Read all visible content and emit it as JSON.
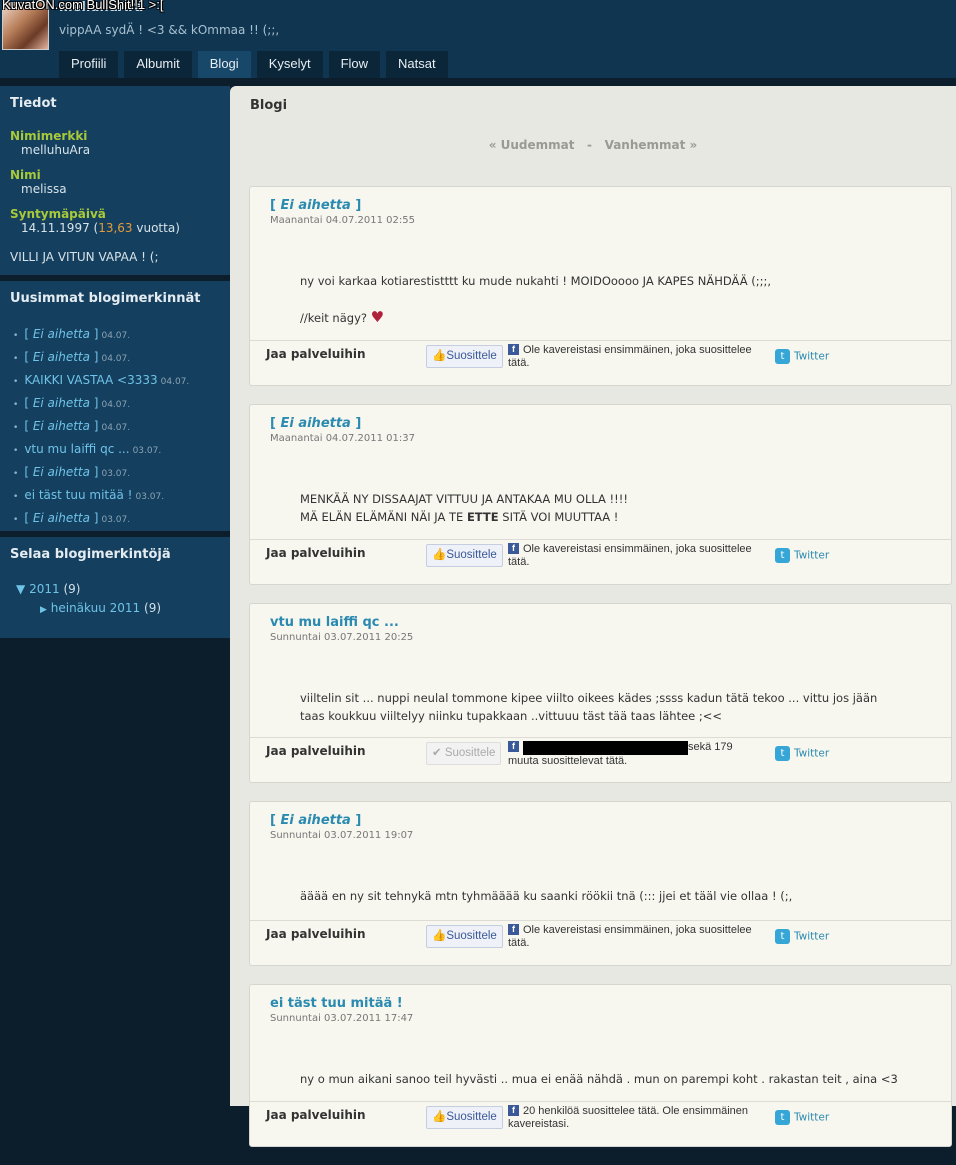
{
  "watermark": "KuvatON.com BullShit!!1 >:[",
  "profile": {
    "username": "melluhuAra",
    "status": "vippAA sydÄ ! <3 && kOmmaa !! (;;,"
  },
  "tabs": [
    "Profiili",
    "Albumit",
    "Blogi",
    "Kyselyt",
    "Flow",
    "Natsat"
  ],
  "sidebar": {
    "info": {
      "title": "Tiedot",
      "nick_label": "Nimimerkki",
      "nick": "melluhuAra",
      "name_label": "Nimi",
      "name": "melissa",
      "bday_label": "Syntymäpäivä",
      "bday": "14.11.1997 (",
      "age": "13,63",
      "age_suffix": " vuotta)",
      "motto": "VILLI JA VITUN VAPAA ! (;"
    },
    "recent": {
      "title": "Uusimmat blogimerkinnät",
      "items": [
        {
          "pre": "[ ",
          "title": "Ei aihetta",
          "post": " ]",
          "date": "04.07."
        },
        {
          "pre": "[ ",
          "title": "Ei aihetta",
          "post": " ]",
          "date": "04.07."
        },
        {
          "pre": "",
          "title": "KAIKKI VASTAA <3333",
          "post": "",
          "date": "04.07."
        },
        {
          "pre": "[ ",
          "title": "Ei aihetta",
          "post": " ]",
          "date": "04.07."
        },
        {
          "pre": "[ ",
          "title": "Ei aihetta",
          "post": " ]",
          "date": "04.07."
        },
        {
          "pre": "",
          "title": "vtu mu laiffi qc ...",
          "post": "",
          "date": "03.07."
        },
        {
          "pre": "[ ",
          "title": "Ei aihetta",
          "post": " ]",
          "date": "03.07."
        },
        {
          "pre": "",
          "title": "ei täst tuu mitää !",
          "post": "",
          "date": "03.07."
        },
        {
          "pre": "[ ",
          "title": "Ei aihetta",
          "post": " ]",
          "date": "03.07."
        }
      ]
    },
    "browse": {
      "title": "Selaa blogimerkintöjä",
      "year": "2011",
      "year_count": "(9)",
      "month": "heinäkuu 2011",
      "month_count": "(9)"
    }
  },
  "main": {
    "title": "Blogi",
    "newer": "« Uudemmat",
    "sep": "-",
    "older": "Vanhemmat »"
  },
  "share": {
    "label": "Jaa palveluihin",
    "recommend": "Suosittele",
    "twitter": "Twitter",
    "first": "Ole kavereistasi ensimmäinen, joka suosittelee tätä."
  },
  "posts": [
    {
      "title": "Ei aihetta",
      "bracket": true,
      "date": "Maanantai 04.07.2011 02:55",
      "lines": [
        "ny voi karkaa kotiarestistttt ku mude nukahti ! MOIDOoooo JA KAPES NÄHDÄÄ (;;;,",
        "",
        "//keit nägy?"
      ]
    },
    {
      "title": "Ei aihetta",
      "bracket": true,
      "date": "Maanantai 04.07.2011 01:37",
      "lines": [
        "MENKÄÄ NY DISSAAJAT VITTUU JA ANTAKAA MU OLLA !!!!"
      ],
      "line2a": "MÄ ELÄN ELÄMÄNI NÄI JA TE ",
      "line2b": "ETTE",
      "line2c": " SITÄ VOI MUUTTAA !"
    },
    {
      "title": "vtu mu laiffi qc ...",
      "bracket": false,
      "date": "Sunnuntai 03.07.2011 20:25",
      "lines": [
        "viiltelin sit ... nuppi neulal tommone kipee viilto oikees kädes ;ssss kadun tätä tekoo ... vittu jos jään",
        "taas koukkuu viiltelyy niinku tupakkaan ..vittuuu täst tää taas lähtee ;<<"
      ],
      "fb_suffix": "sekä 179 muuta suosittelevat tätä."
    },
    {
      "title": "Ei aihetta",
      "bracket": true,
      "date": "Sunnuntai 03.07.2011 19:07",
      "lines": [
        "ääää en ny sit tehnykä mtn tyhmääää ku saanki röökii tnä (::: jjei et tääl vie ollaa ! (;,"
      ]
    },
    {
      "title": "ei täst tuu mitää !",
      "bracket": false,
      "date": "Sunnuntai 03.07.2011 17:47",
      "lines": [
        "ny o mun aikani sanoo teil hyvästi .. mua ei enää nähdä . mun on parempi koht . rakastan teit , aina <3"
      ],
      "fb_text": "20 henkilöä suosittelee tätä. Ole ensimmäinen kavereistasi."
    }
  ]
}
